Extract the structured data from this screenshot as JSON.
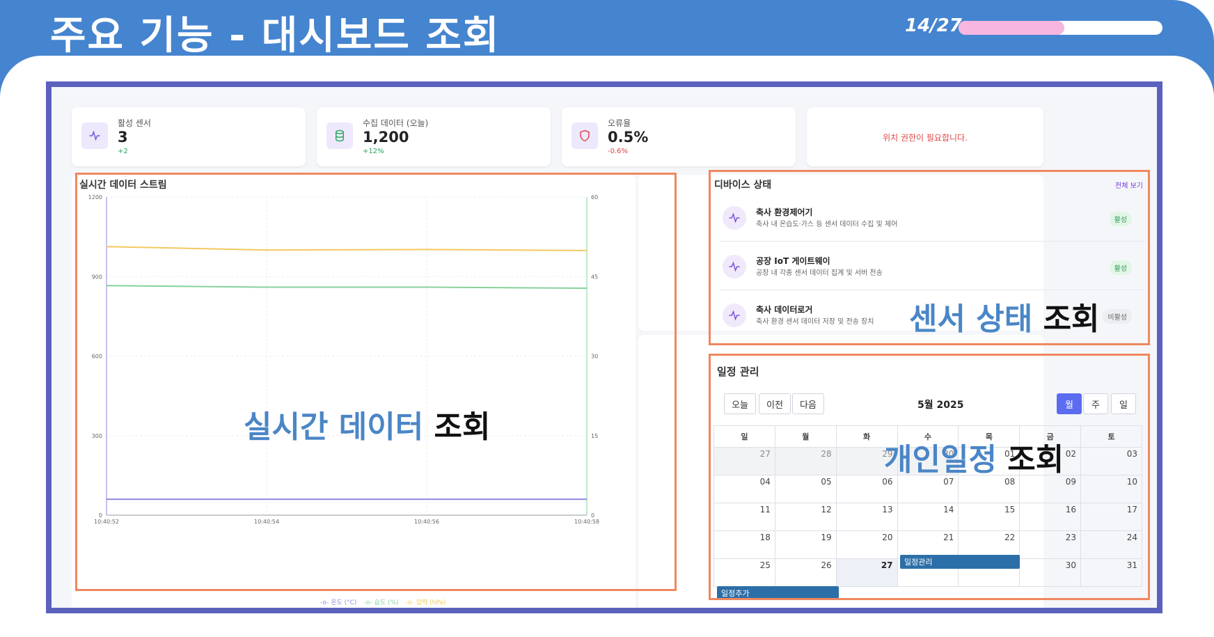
{
  "slide": {
    "title": "주요 기능 - 대시보드 조회",
    "page": "14/27",
    "progress_fraction": 0.52
  },
  "stats": [
    {
      "label": "활성 센서",
      "value": "3",
      "delta": "+2",
      "icon": "activity-icon"
    },
    {
      "label": "수집 데이터 (오늘)",
      "value": "1,200",
      "delta": "+12%",
      "icon": "database-icon"
    },
    {
      "label": "오류율",
      "value": "0.5%",
      "delta": "-0.6%",
      "icon": "shield-icon"
    }
  ],
  "location_message": "위치 권한이 필요합니다.",
  "stream": {
    "title": "실시간 데이터 스트림",
    "overlay_blue": "실시간 데이터",
    "overlay_black": "조회"
  },
  "devices": {
    "title": "디바이스 상태",
    "view_all": "전체 보기",
    "overlay_blue": "센서 상태",
    "overlay_black": "조회",
    "items": [
      {
        "name": "축사 환경제어기",
        "desc": "축사 내 온습도·가스 등 센서 데이터 수집 및 제어",
        "status": "활성"
      },
      {
        "name": "공장 IoT 게이트웨이",
        "desc": "공장 내 각종 센서 데이터 집계 및 서버 전송",
        "status": "활성"
      },
      {
        "name": "축사 데이터로거",
        "desc": "축사 환경 센서 데이터 저장 및 전송 장치",
        "status": "비활성"
      }
    ]
  },
  "calendar": {
    "title": "일정 관리",
    "today_btn": "오늘",
    "prev_btn": "이전",
    "next_btn": "다음",
    "month_label": "5월 2025",
    "view_month": "월",
    "view_week": "주",
    "view_day": "일",
    "weekdays": [
      "일",
      "월",
      "화",
      "수",
      "목",
      "금",
      "토"
    ],
    "weeks": [
      [
        "27",
        "28",
        "29",
        "30",
        "01",
        "02",
        "03"
      ],
      [
        "04",
        "05",
        "06",
        "07",
        "08",
        "09",
        "10"
      ],
      [
        "11",
        "12",
        "13",
        "14",
        "15",
        "16",
        "17"
      ],
      [
        "18",
        "19",
        "20",
        "21",
        "22",
        "23",
        "24"
      ],
      [
        "25",
        "26",
        "27",
        "28",
        "29",
        "30",
        "31"
      ]
    ],
    "events": [
      "일정관리",
      "일정추가"
    ],
    "overlay_blue": "개인일정",
    "overlay_black": "조회"
  },
  "chart_data": {
    "type": "line",
    "title": "실시간 데이터 스트림",
    "x": [
      "10:40:52",
      "10:40:54",
      "10:40:56",
      "10:40:58"
    ],
    "y_left_ticks": [
      "0",
      "300",
      "600",
      "900",
      "1200"
    ],
    "y_right_ticks": [
      "0",
      "15",
      "30",
      "45",
      "60"
    ],
    "ylim_left": [
      0,
      1200
    ],
    "ylim_right": [
      0,
      60
    ],
    "series": [
      {
        "name": "온도 (°C)",
        "axis": "right",
        "color": "#8f8ae0",
        "values": [
          3,
          3,
          3,
          3
        ]
      },
      {
        "name": "습도 (%)",
        "axis": "right",
        "color": "#86d29a",
        "values": [
          43.3,
          43.0,
          43.0,
          42.8
        ]
      },
      {
        "name": "압력 (hPa)",
        "axis": "left",
        "color": "#f5c860",
        "values": [
          1013,
          1000,
          1002,
          998
        ]
      }
    ],
    "grid": true,
    "legend": "bottom"
  }
}
